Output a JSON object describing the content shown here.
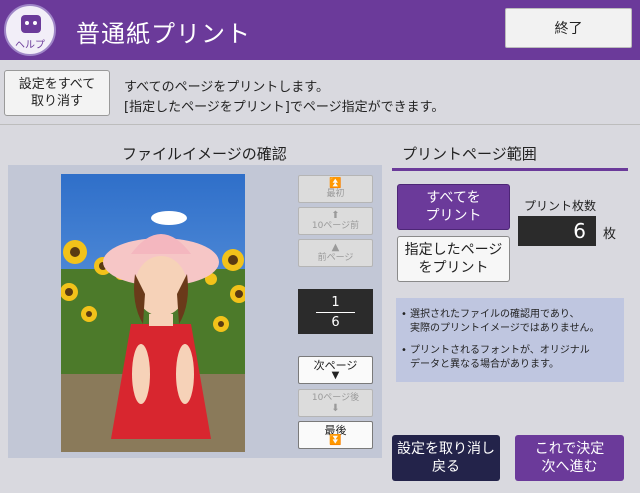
{
  "header": {
    "title": "普通紙プリント",
    "help_label": "ヘルプ",
    "end_label": "終了"
  },
  "top": {
    "cancel_all_line1": "設定をすべて",
    "cancel_all_line2": "取り消す",
    "instruction_line1": "すべてのページをプリントします。",
    "instruction_line2": "[指定したページをプリント]でページ指定ができます。"
  },
  "preview": {
    "section_title": "ファイルイメージの確認",
    "nav": {
      "first": "最初",
      "back10": "10ページ前",
      "prev": "前ページ",
      "next": "次ページ",
      "fwd10": "10ページ後",
      "last": "最後"
    },
    "current_page": "1",
    "total_pages": "6"
  },
  "print_range": {
    "section_title": "プリントページ範囲",
    "all_line1": "すべてを",
    "all_line2": "プリント",
    "selected_line1": "指定したページ",
    "selected_line2": "をプリント",
    "count_label": "プリント枚数",
    "count_value": "6",
    "count_unit": "枚",
    "note1_line1": "選択されたファイルの確認用であり、",
    "note1_line2": "実際のプリントイメージではありません。",
    "note2_line1": "プリントされるフォントが、オリジナル",
    "note2_line2": "データと異なる場合があります。"
  },
  "footer": {
    "undo_line1": "設定を取り消し",
    "undo_line2": "戻る",
    "next_line1": "これで決定",
    "next_line2": "次へ進む"
  },
  "colors": {
    "brand_purple": "#6b3a9a",
    "dark_navy": "#23234a",
    "note_bg": "#bfc6e0"
  }
}
